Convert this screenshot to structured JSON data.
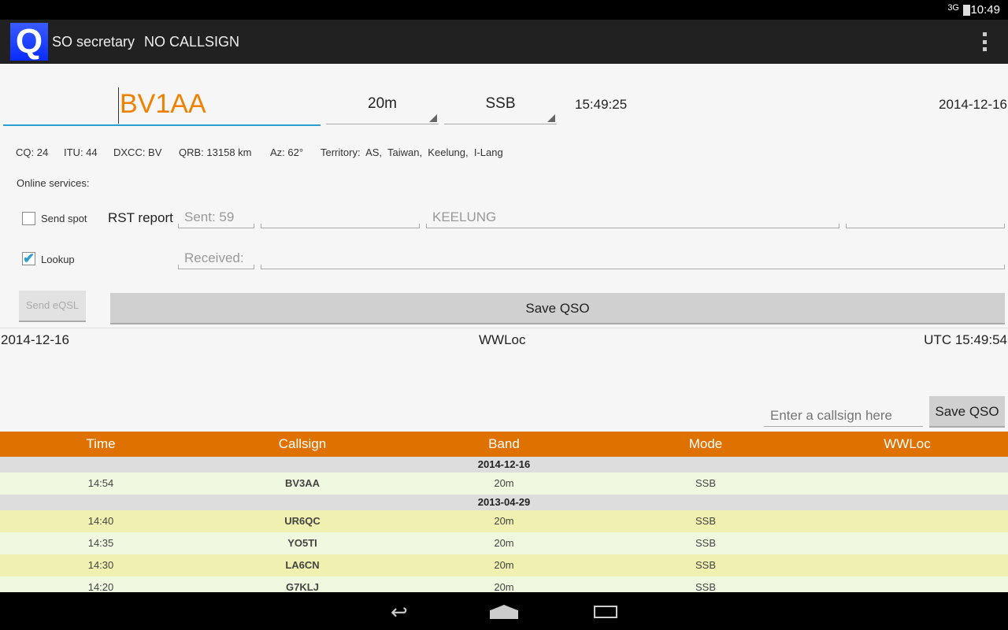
{
  "status": {
    "network": "3G",
    "time": "10:49"
  },
  "appbar": {
    "logo": "Q",
    "title": "SO secretary",
    "callsign": "NO CALLSIGN"
  },
  "entry": {
    "callsign": "BV1AA",
    "band": "20m",
    "mode": "SSB",
    "time": "15:49:25",
    "date": "2014-12-16"
  },
  "info": {
    "cq": "CQ: 24",
    "itu": "ITU: 44",
    "dxcc": "DXCC: BV",
    "qrb": "QRB: 13158 km",
    "az": "Az: 62°",
    "territory": "Territory:  AS,  Taiwan,  Keelung,  I-Lang"
  },
  "online_services": "Online services:",
  "send_spot": {
    "label": "Send spot",
    "checked": false
  },
  "lookup": {
    "label": "Lookup",
    "checked": true
  },
  "rst_label": "RST report",
  "sent": "Sent: 59",
  "qth": "KEELUNG",
  "received": "Received:",
  "send_eqsl": "Send eQSL",
  "save_qso": "Save QSO",
  "footer": {
    "date": "2014-12-16",
    "wwloc": "WWLoc",
    "utc": "UTC 15:49:54"
  },
  "quick": {
    "placeholder": "Enter a callsign here",
    "save": "Save QSO"
  },
  "table": {
    "headers": [
      "Time",
      "Callsign",
      "Band",
      "Mode",
      "WWLoc"
    ],
    "groups": [
      {
        "date": "2014-12-16",
        "rows": [
          [
            "14:54",
            "BV3AA",
            "20m",
            "SSB",
            ""
          ]
        ]
      },
      {
        "date": "2013-04-29",
        "rows": [
          [
            "14:40",
            "UR6QC",
            "20m",
            "SSB",
            ""
          ],
          [
            "14:35",
            "YO5TI",
            "20m",
            "SSB",
            ""
          ],
          [
            "14:30",
            "LA6CN",
            "20m",
            "SSB",
            ""
          ],
          [
            "14:20",
            "G7KLJ",
            "20m",
            "SSB",
            ""
          ]
        ]
      }
    ]
  },
  "colors": {
    "accent": "#de7100",
    "callsign": "#f08000",
    "focus": "#2a9fd0"
  }
}
